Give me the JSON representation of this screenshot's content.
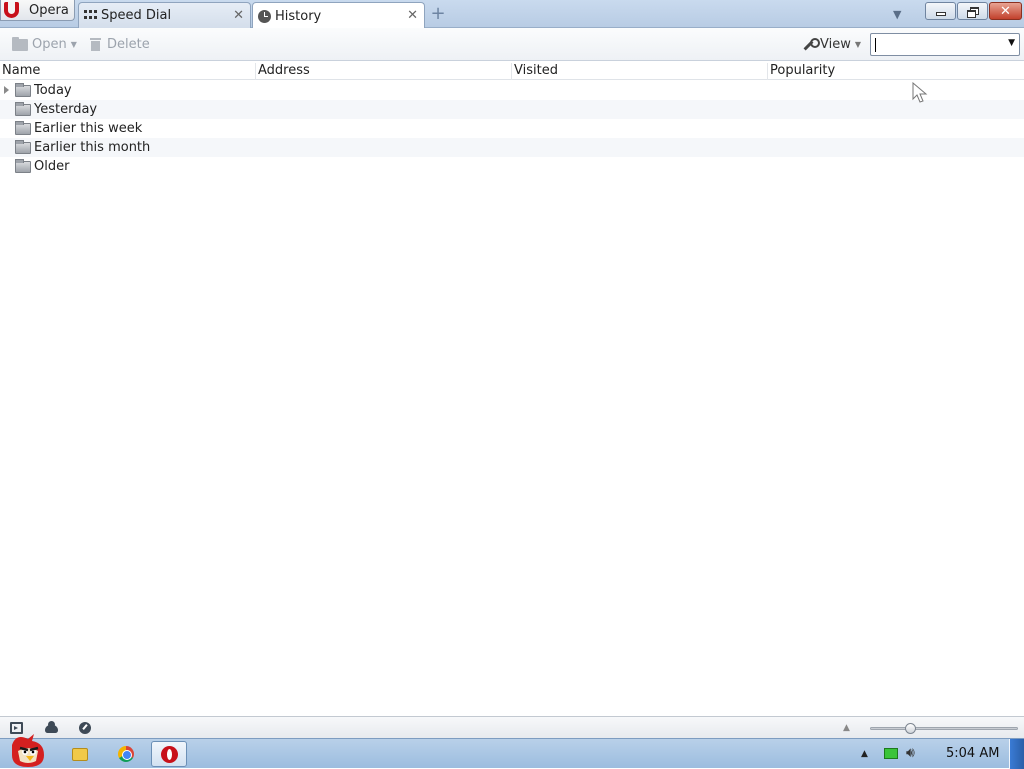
{
  "app": {
    "menu_button_label": "Opera"
  },
  "tabs": [
    {
      "label": "Speed Dial",
      "icon": "speed-dial-grid-icon",
      "active": false
    },
    {
      "label": "History",
      "icon": "clock-icon",
      "active": true
    }
  ],
  "toolbar": {
    "open_label": "Open",
    "delete_label": "Delete",
    "view_label": "View",
    "search_value": ""
  },
  "columns": [
    "Name",
    "Address",
    "Visited",
    "Popularity"
  ],
  "history_folders": [
    {
      "label": "Today",
      "expandable": true
    },
    {
      "label": "Yesterday",
      "expandable": false
    },
    {
      "label": "Earlier this week",
      "expandable": false
    },
    {
      "label": "Earlier this month",
      "expandable": false
    },
    {
      "label": "Older",
      "expandable": false
    }
  ],
  "taskbar": {
    "clock": "5:04 AM"
  },
  "colors": {
    "tab_strip": "#c9daee",
    "close_button": "#c2412c",
    "opera_red": "#c8101a"
  }
}
